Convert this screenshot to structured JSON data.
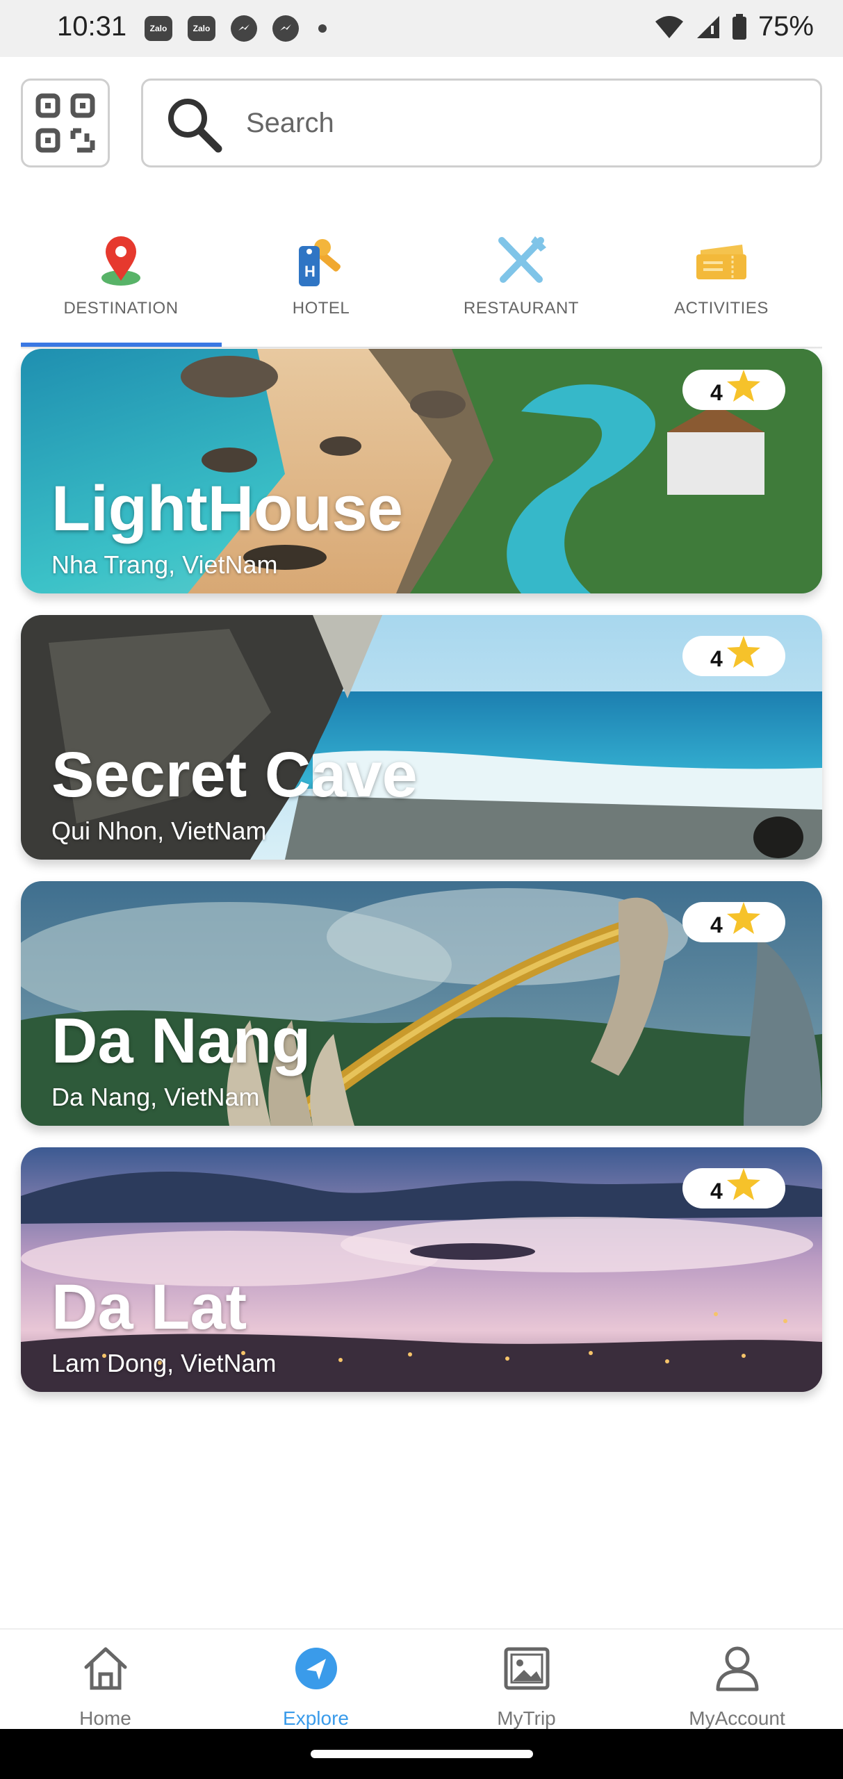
{
  "status_bar": {
    "time": "10:31",
    "notifications": [
      "Zalo",
      "Zalo"
    ],
    "battery": "75%"
  },
  "search": {
    "placeholder": "Search",
    "value": ""
  },
  "categories": [
    {
      "label": "DESTINATION",
      "icon": "location-pin-icon",
      "active": true
    },
    {
      "label": "HOTEL",
      "icon": "hotel-key-icon",
      "active": false
    },
    {
      "label": "RESTAURANT",
      "icon": "cutlery-icon",
      "active": false
    },
    {
      "label": "ACTIVITIES",
      "icon": "ticket-icon",
      "active": false
    }
  ],
  "destinations": [
    {
      "title": "LightHouse",
      "location": "Nha Trang, VietNam",
      "rating": "4"
    },
    {
      "title": "Secret Cave",
      "location": "Qui Nhon, VietNam",
      "rating": "4"
    },
    {
      "title": "Da Nang",
      "location": "Da Nang, VietNam",
      "rating": "4"
    },
    {
      "title": "Da Lat",
      "location": "Lam Dong, VietNam",
      "rating": "4"
    }
  ],
  "bottom_nav": [
    {
      "label": "Home",
      "icon": "home-icon",
      "active": false
    },
    {
      "label": "Explore",
      "icon": "compass-icon",
      "active": true
    },
    {
      "label": "MyTrip",
      "icon": "gallery-icon",
      "active": false
    },
    {
      "label": "MyAccount",
      "icon": "user-icon",
      "active": false
    }
  ],
  "colors": {
    "accent": "#3a78e3",
    "active_nav": "#3a9bea",
    "star": "#f6c22a"
  }
}
